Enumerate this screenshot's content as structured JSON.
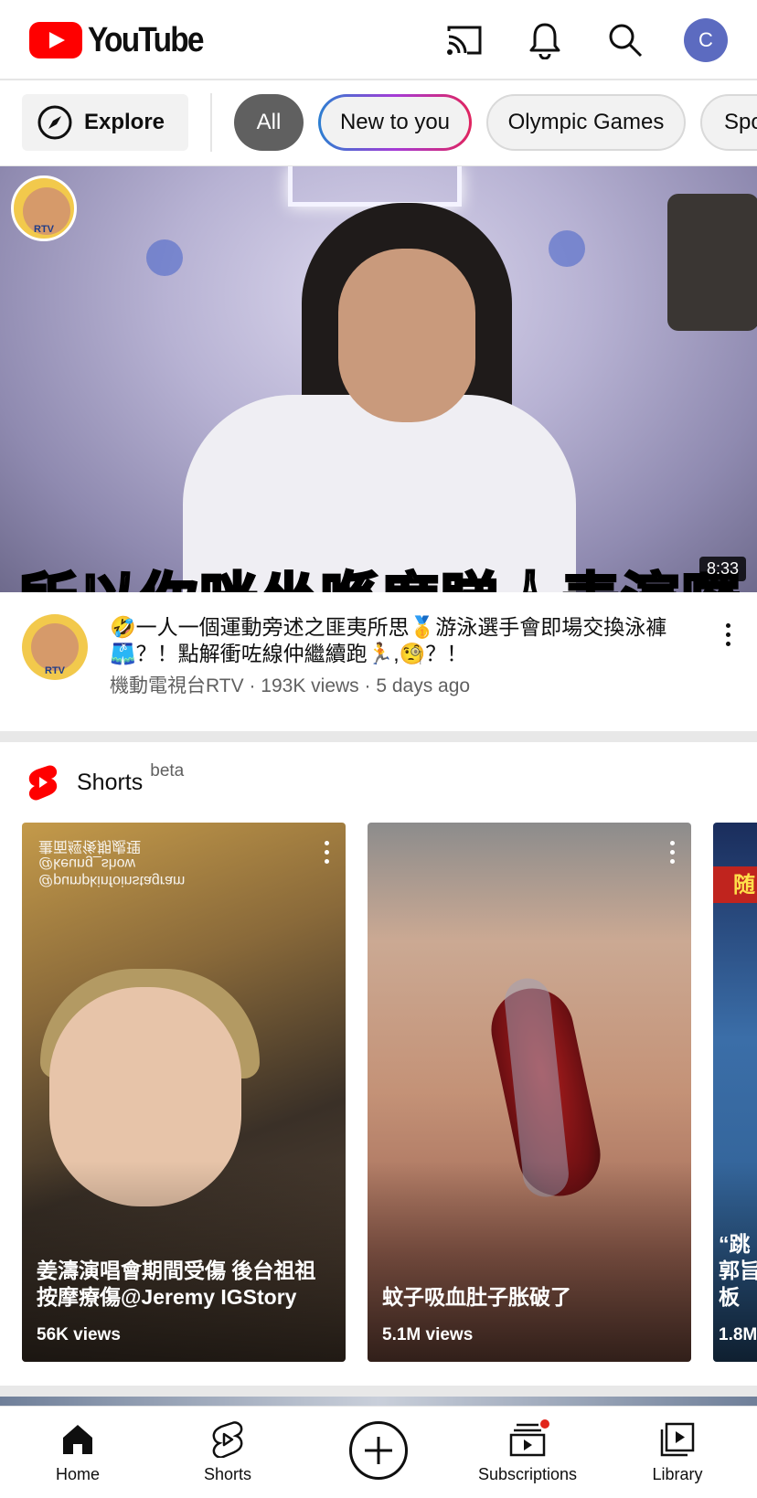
{
  "header": {
    "logo_text": "YouTube",
    "avatar_letter": "C",
    "brand_color": "#ff0000",
    "icons": [
      "cast-icon",
      "bell-icon",
      "search-icon"
    ]
  },
  "chips": {
    "explore_label": "Explore",
    "items": [
      {
        "label": "All",
        "selected": true
      },
      {
        "label": "New to you",
        "selected": false
      },
      {
        "label": "Olympic Games",
        "selected": false
      },
      {
        "label": "Spo",
        "selected": false
      }
    ]
  },
  "video": {
    "subtitle_overlay": "所以你咪坐喺度睇人表演囉",
    "duration": "8:33",
    "badge_text": "RTV",
    "title": "🤣一人一個運動旁述之匪夷所思🥇游泳選手會即場交換泳褲🩳？！點解衝咗線仲繼續跑🏃,🧐？！",
    "meta": "機動電視台RTV · 193K views · 5 days ago"
  },
  "shorts": {
    "title": "Shorts",
    "beta": "beta",
    "items": [
      {
        "watermark": "@pumpkinfoinstagram\n@keung_show\n畫面經後期處理",
        "title": "姜濤演唱會期間受傷 後台祖祖按摩療傷@Jeremy IGStory",
        "views": "56K views"
      },
      {
        "title": "蚊子吸血肚子胀破了",
        "views": "5.1M views"
      },
      {
        "badge": "随",
        "title_lines": [
          "“跳",
          "郭旨",
          "板"
        ],
        "views": "1.8M"
      }
    ]
  },
  "bottom_nav": {
    "items": [
      {
        "label": "Home"
      },
      {
        "label": "Shorts"
      },
      {
        "label": "Subscriptions"
      },
      {
        "label": "Library"
      }
    ],
    "notification_color": "#e1251b"
  }
}
